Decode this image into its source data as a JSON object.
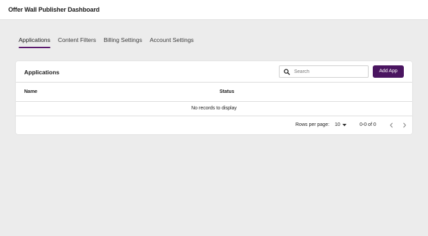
{
  "header": {
    "title": "Offer Wall Publisher Dashboard"
  },
  "tabs": [
    {
      "label": "Applications",
      "active": true
    },
    {
      "label": "Content Filters",
      "active": false
    },
    {
      "label": "Billing Settings",
      "active": false
    },
    {
      "label": "Account Settings",
      "active": false
    }
  ],
  "card": {
    "title": "Applications",
    "search": {
      "placeholder": "Search",
      "value": ""
    },
    "add_button": "Add App",
    "columns": [
      "Name",
      "Status"
    ],
    "empty_message": "No records to display",
    "pagination": {
      "rows_per_page_label": "Rows per page:",
      "rows_per_page": "10",
      "range": "0-0 of 0"
    }
  },
  "colors": {
    "accent": "#4a1560",
    "background": "#ececec"
  },
  "icons": [
    "search-icon",
    "caret-down-icon",
    "chevron-left-icon",
    "chevron-right-icon"
  ]
}
